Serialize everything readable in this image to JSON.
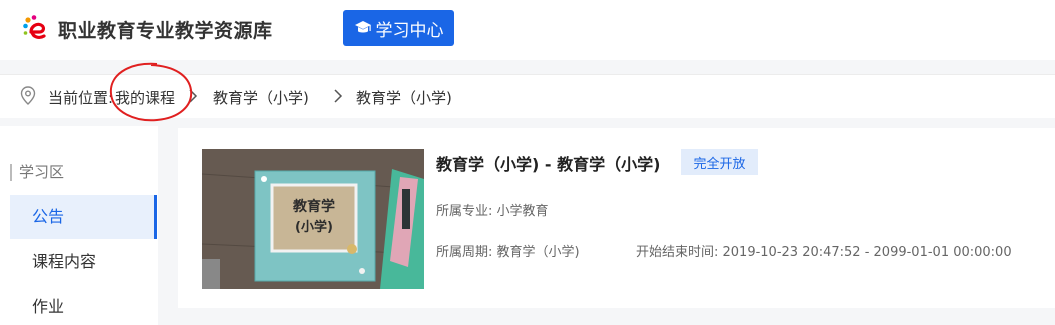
{
  "header": {
    "site_title": "职业教育专业教学资源库",
    "study_center_label": "学习中心",
    "logo_icon": "colorful-e-logo-icon",
    "accent_color": "#1a66e6"
  },
  "breadcrumb": {
    "prefix": "当前位置:",
    "items": [
      "我的课程",
      "教育学（小学)",
      "教育学（小学)"
    ],
    "separator_icon": "chevron-right-icon",
    "location_icon": "map-pin-icon",
    "highlight_color": "#e02020"
  },
  "sidebar": {
    "section_title": "学习区",
    "items": [
      {
        "label": "公告",
        "active": true
      },
      {
        "label": "课程内容",
        "active": false
      },
      {
        "label": "作业",
        "active": false
      }
    ]
  },
  "course": {
    "title": "教育学（小学) - 教育学（小学)",
    "badge": "完全开放",
    "major": "所属专业: 小学教育",
    "period": "所属周期: 教育学（小学)",
    "time_range": "开始结束时间: 2019-10-23 20:47:52 - 2099-01-01 00:00:00",
    "thumbnail_text": "教育学\n(小学)"
  }
}
